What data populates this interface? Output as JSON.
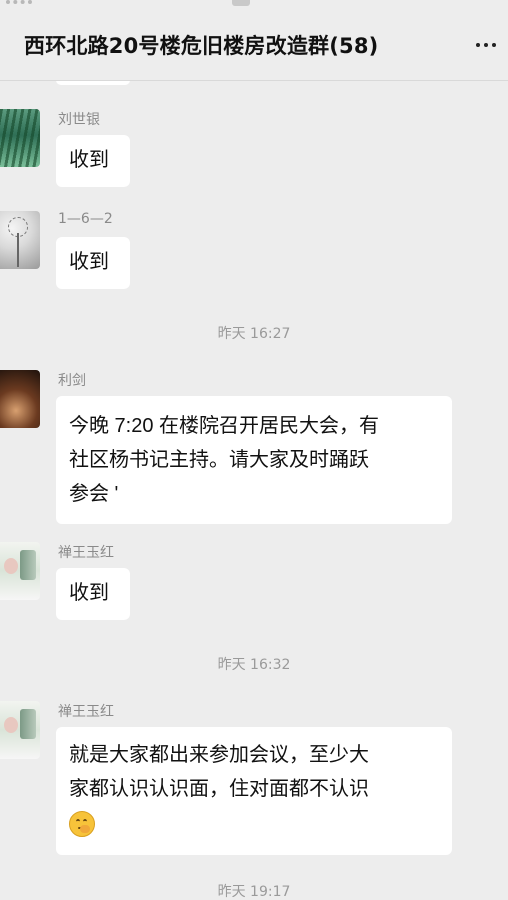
{
  "header": {
    "title": "西环北路20号楼危旧楼房改造群(58)",
    "more_icon": "ellipsis-icon"
  },
  "messages": [
    {
      "sender": "刘世银",
      "text": "收到",
      "avatar": "green-willow-avatar"
    },
    {
      "sender": "1—6—2",
      "text": "收到",
      "avatar": "dandelion-avatar"
    },
    {
      "sender": "利剑",
      "lines": [
        "今晚 7:20 在楼院召开居民大会，有",
        "社区杨书记主持。请大家及时踊跃",
        "参会 '"
      ],
      "avatar": "dark-photo-avatar"
    },
    {
      "sender": "禅王玉红",
      "text": "收到",
      "avatar": "light-photo-avatar"
    },
    {
      "sender": "禅王玉红",
      "lines": [
        "就是大家都出来参加会议，至少大",
        "家都认识认识面，住对面都不认识"
      ],
      "emoji": "thinking-face",
      "avatar": "light-photo-avatar"
    }
  ],
  "timestamps": [
    "昨天 16:27",
    "昨天 16:32",
    "昨天 19:17"
  ],
  "colors": {
    "background": "#ededed",
    "bubble": "#ffffff",
    "timestamp": "#9a9a9a",
    "sender": "#8a8a8a"
  }
}
